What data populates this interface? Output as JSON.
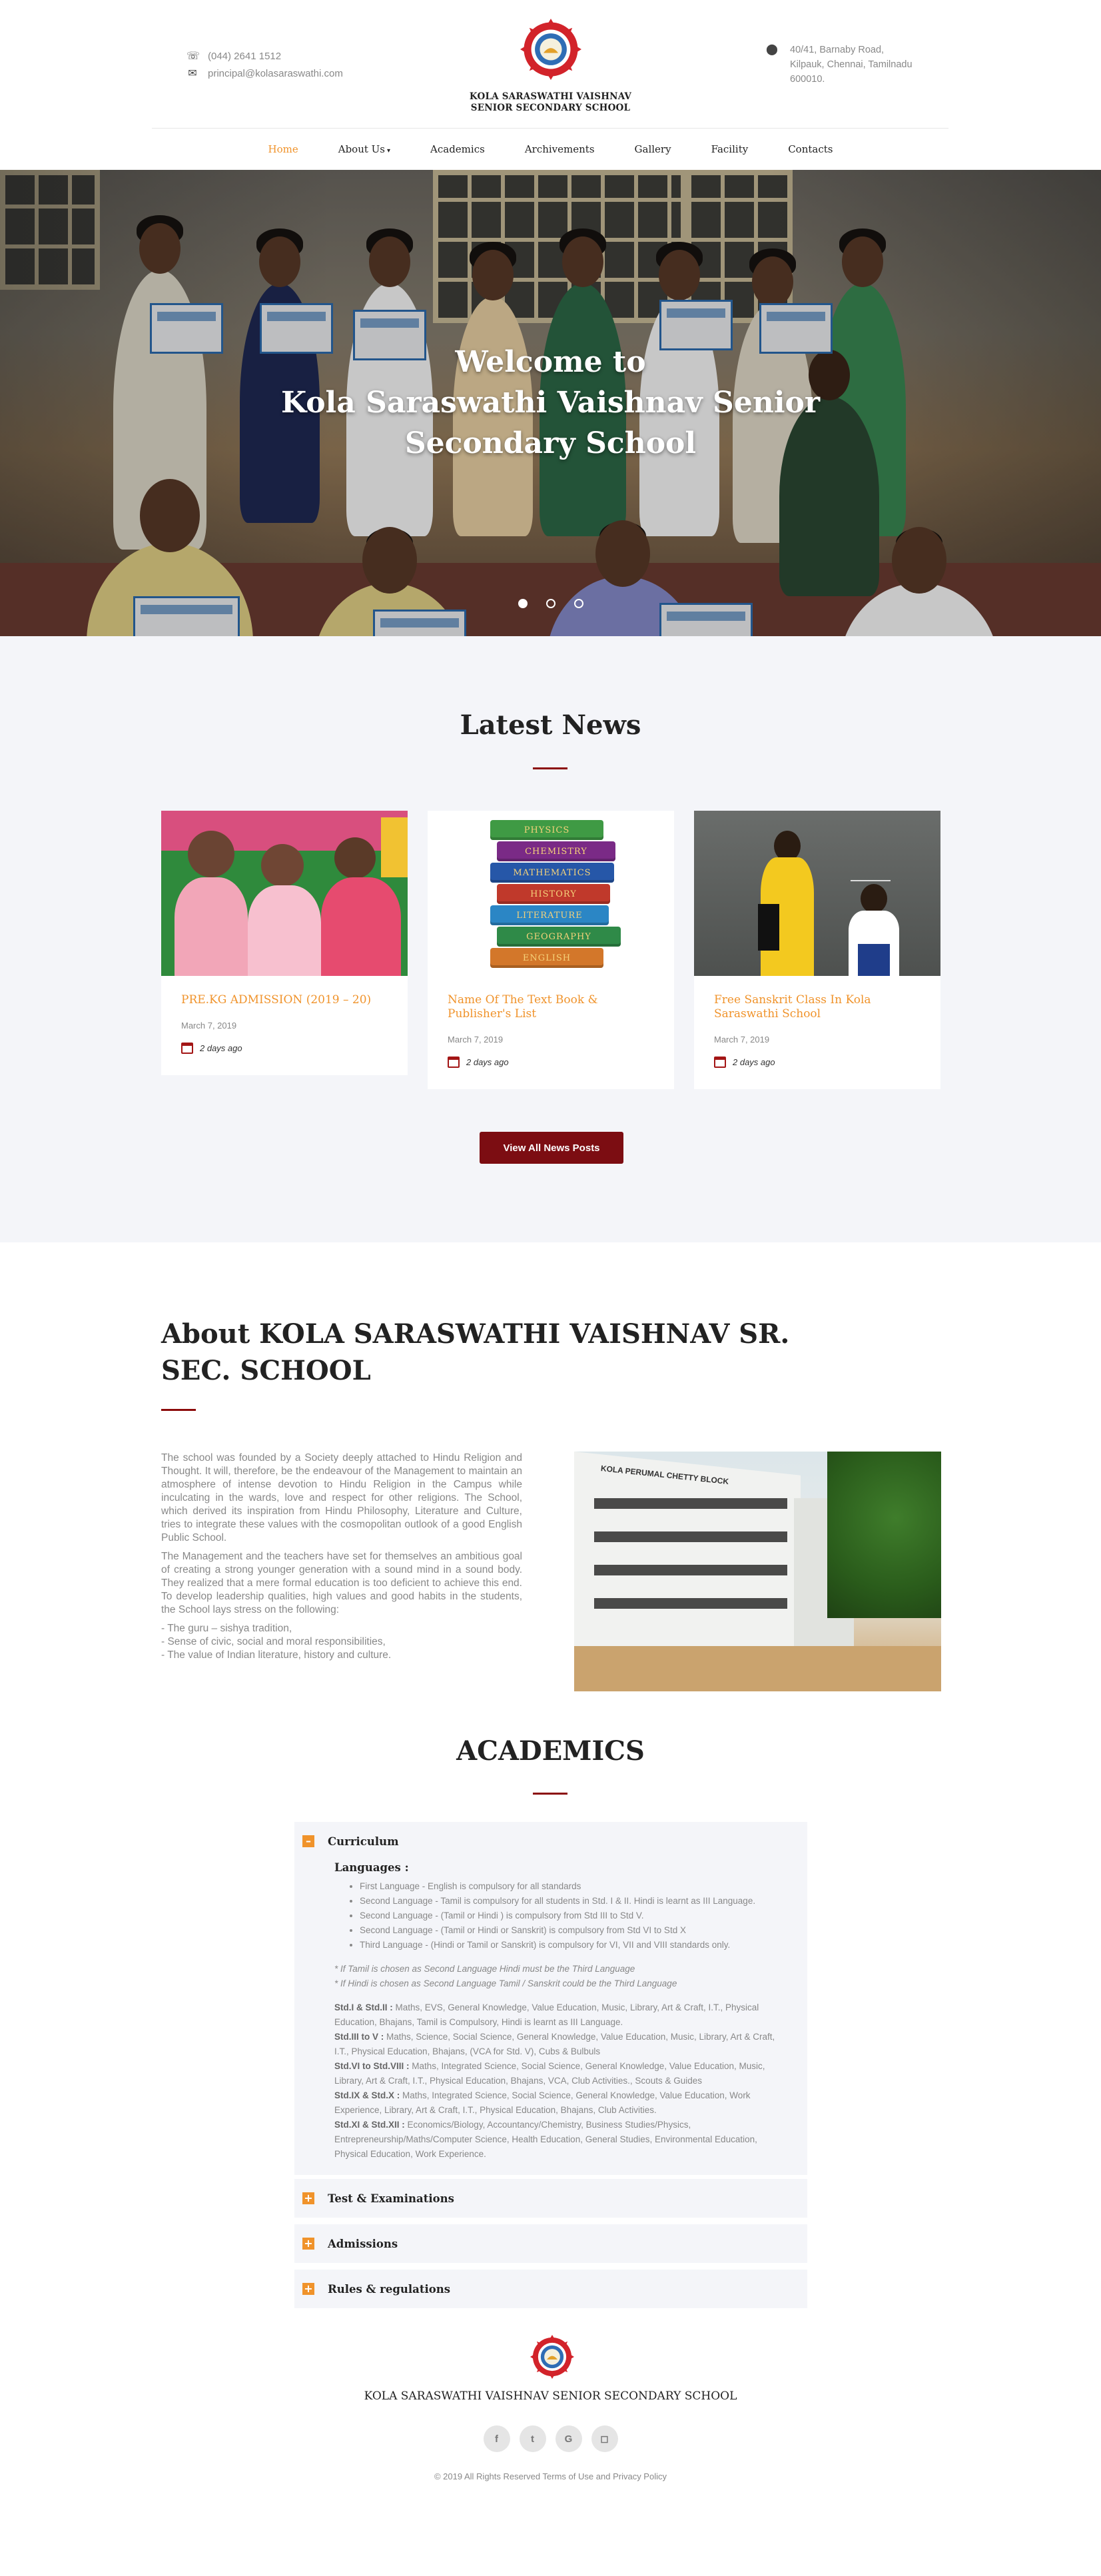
{
  "header": {
    "phone": "(044) 2641 1512",
    "email": "principal@kolasaraswathi.com",
    "school_name_line1": "KOLA SARASWATHI VAISHNAV",
    "school_name_line2": "SENIOR SECONDARY SCHOOL",
    "address_line1": "40/41, Barnaby Road,",
    "address_line2": "Kilpauk, Chennai, Tamilnadu",
    "address_line3": "600010."
  },
  "nav": {
    "items": [
      {
        "label": "Home",
        "active": true
      },
      {
        "label": "About Us",
        "dropdown": true
      },
      {
        "label": "Academics"
      },
      {
        "label": "Archivements"
      },
      {
        "label": "Gallery"
      },
      {
        "label": "Facility"
      },
      {
        "label": "Contacts"
      }
    ]
  },
  "hero": {
    "line1": "Welcome to",
    "line2": "Kola Saraswathi Vaishnav Senior",
    "line3": "Secondary School",
    "slides": 3,
    "active_slide": 1
  },
  "news": {
    "title": "Latest News",
    "cards": [
      {
        "title": "PRE.KG ADMISSION (2019 – 20)",
        "date": "March 7, 2019",
        "ago": "2 days ago"
      },
      {
        "title": "Name Of The Text Book & Publisher's List",
        "date": "March 7, 2019",
        "ago": "2 days ago"
      },
      {
        "title": "Free Sanskrit Class In Kola Saraswathi School",
        "date": "March 7, 2019",
        "ago": "2 days ago"
      }
    ],
    "book_labels": [
      "PHYSICS",
      "CHEMISTRY",
      "MATHEMATICS",
      "HISTORY",
      "LITERATURE",
      "GEOGRAPHY",
      "ENGLISH"
    ],
    "view_all": "View All News Posts"
  },
  "about": {
    "title": "About KOLA SARASWATHI VAISHNAV SR. SEC. SCHOOL",
    "para1": "The school was founded by a Society deeply attached to Hindu Religion and Thought. It will, therefore, be the endeavour of the Management to maintain an atmosphere of intense devotion to Hindu Religion in the Campus while inculcating in the wards, love and respect for other religions. The School, which derived its inspiration from Hindu Philosophy, Literature and Culture, tries to integrate these values with the cosmopolitan outlook of a good English Public School.",
    "para2": "The Management and the teachers have set for themselves an ambitious goal of creating a strong younger generation with a sound mind in a sound body. They realized that a mere formal education is too deficient to achieve this end. To develop leadership qualities, high values and good habits in the students, the School lays stress on the following:",
    "points": [
      "- The guru – sishya tradition,",
      "- Sense of civic, social and moral responsibilities,",
      "- The value of Indian literature, history and culture."
    ],
    "building_sign": "KOLA  PERUMAL  CHETTY  BLOCK"
  },
  "academics": {
    "title": "ACADEMICS",
    "curriculum": {
      "label": "Curriculum",
      "toggle": "–",
      "languages_heading": "Languages :",
      "languages": [
        "First Language - English is compulsory for all standards",
        "Second Language - Tamil is compulsory for all students in Std. I & II. Hindi is learnt as III Language.",
        "Second Language - (Tamil or Hindi ) is compulsory from Std III to Std V.",
        "Second Language - (Tamil or Hindi or Sanskrit) is compulsory from Std VI to Std X",
        "Third Language - (Hindi or Tamil or Sanskrit) is compulsory for VI, VII and VIII standards only."
      ],
      "note1": "* If Tamil is chosen as Second Language Hindi must be the Third Language",
      "note2": "* If Hindi is chosen as Second Language Tamil / Sanskrit could be the Third Language",
      "subjects": [
        {
          "std": "Std.I & Std.II :",
          "text": " Maths, EVS, General Knowledge, Value Education, Music, Library, Art & Craft, I.T., Physical Education, Bhajans, Tamil is Compulsory, Hindi is learnt as III Language."
        },
        {
          "std": "Std.III to V :",
          "text": " Maths, Science, Social Science, General Knowledge, Value Education, Music, Library, Art & Craft, I.T., Physical Education, Bhajans, (VCA for Std. V), Cubs & Bulbuls"
        },
        {
          "std": "Std.VI to Std.VIII :",
          "text": " Maths, Integrated Science, Social Science, General Knowledge, Value Education, Music, Library, Art & Craft, I.T., Physical Education, Bhajans, VCA, Club Activities., Scouts & Guides"
        },
        {
          "std": "Std.IX & Std.X :",
          "text": " Maths, Integrated Science, Social Science, General Knowledge, Value Education, Work Experience, Library, Art & Craft, I.T., Physical Education, Bhajans, Club Activities."
        },
        {
          "std": "Std.XI & Std.XII :",
          "text": " Economics/Biology, Accountancy/Chemistry, Business Studies/Physics, Entrepreneurship/Maths/Computer Science, Health Education, General Studies, Environmental Education, Physical Education, Work Experience."
        }
      ]
    },
    "collapsed": [
      {
        "label": "Test & Examinations",
        "toggle": "+"
      },
      {
        "label": "Admissions",
        "toggle": "+"
      },
      {
        "label": "Rules & regulations",
        "toggle": "+"
      }
    ]
  },
  "footer": {
    "school_name": "KOLA SARASWATHI VAISHNAV SENIOR SECONDARY SCHOOL",
    "socials": [
      {
        "icon": "facebook-icon",
        "glyph": "f"
      },
      {
        "icon": "twitter-icon",
        "glyph": "t"
      },
      {
        "icon": "google-icon",
        "glyph": "G"
      },
      {
        "icon": "instagram-icon",
        "glyph": "◻"
      }
    ],
    "copyright": "© 2019 All Rights Reserved",
    "terms": "Terms of Use",
    "and": "and",
    "privacy": "Privacy Policy"
  },
  "colors": {
    "accent_orange": "#f0932b",
    "brand_maroon": "#7c0d12",
    "section_bg": "#f4f5f9"
  }
}
